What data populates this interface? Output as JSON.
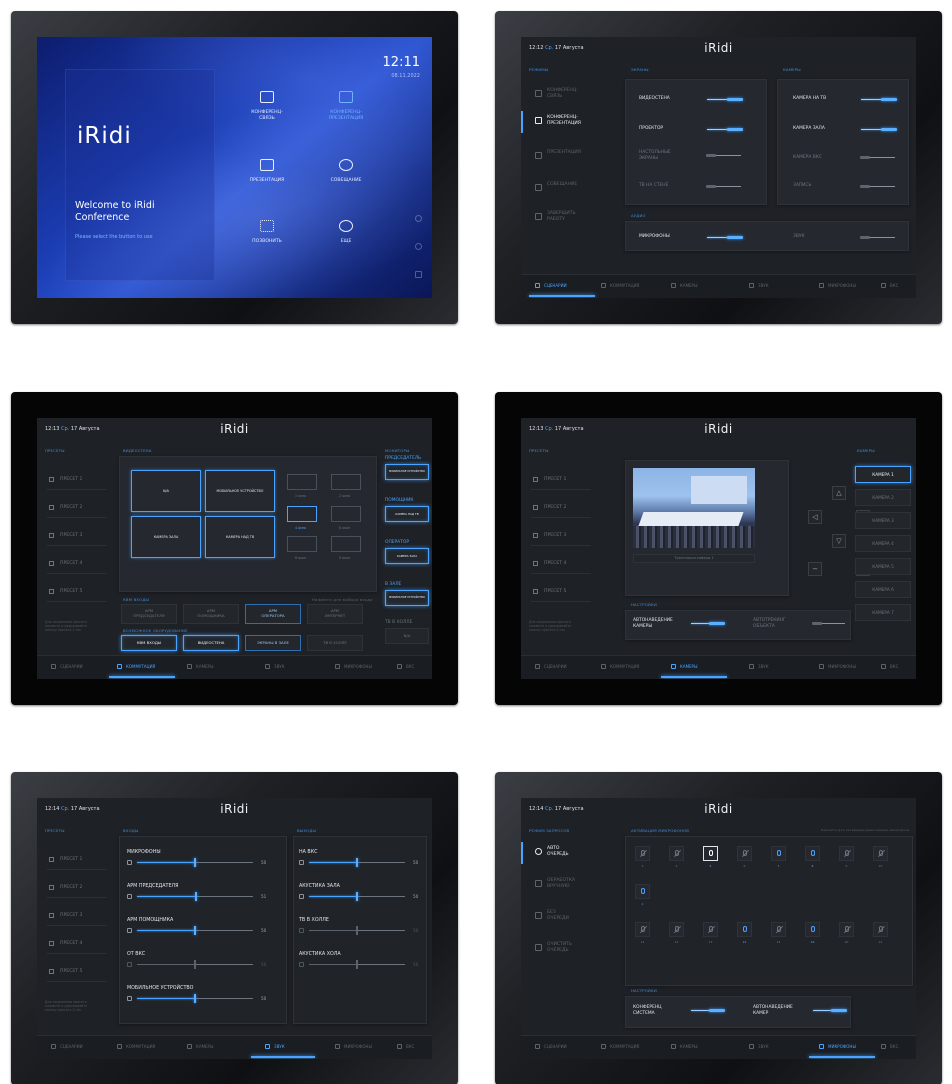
{
  "welcome": {
    "logo": "iRidi",
    "title": "Welcome to iRidi Conference",
    "subtitle": "Please select the button to use",
    "time": "12:11",
    "date": "08.11.2022",
    "items": [
      {
        "label": "КОНФЕРЕНЦ-\nСВЯЗЬ",
        "icon": "video-conference-icon"
      },
      {
        "label": "КОНФЕРЕНЦ-\nПРЕЗЕНТАЦИЯ",
        "icon": "conference-presentation-icon"
      },
      {
        "label": "ПРЕЗЕНТАЦИЯ",
        "icon": "presentation-icon"
      },
      {
        "label": "СОВЕЩАНИЕ",
        "icon": "meeting-icon"
      },
      {
        "label": "ПОЗВОНИТЬ",
        "icon": "dialpad-icon"
      },
      {
        "label": "ЕЩЕ",
        "icon": "more-icon"
      }
    ]
  },
  "logo": "iRidi",
  "tabs": [
    "СЦЕНАРИИ",
    "КОММУТАЦИЯ",
    "КАМЕРЫ",
    "ЗВУК",
    "МИКРОФОНЫ",
    "ВКС"
  ],
  "screen_modes": {
    "time": "12:12",
    "day": "Ср.",
    "date": "17 Августа",
    "sec_modes": "РЕЖИМЫ",
    "sec_screens": "ЭКРАНЫ",
    "sec_cameras": "КАМЕРЫ",
    "sec_audio": "АУДИО",
    "menu": [
      {
        "label": "КОНФЕРЕНЦ-\nСВЯЗЬ"
      },
      {
        "label": "КОНФЕРЕНЦ-\nПРЕЗЕНТАЦИЯ"
      },
      {
        "label": "ПРЕЗЕНТАЦИЯ"
      },
      {
        "label": "СОВЕЩАНИЕ"
      },
      {
        "label": "ЗАВЕРШИТЬ\nРАБОТУ"
      }
    ],
    "screens": [
      {
        "label": "ВИДЕОСТЕНА",
        "on": true
      },
      {
        "label": "ПРОЕКТОР",
        "on": true
      },
      {
        "label": "НАСТОЛЬНЫЕ\nЭКРАНЫ",
        "on": false
      },
      {
        "label": "ТВ НА СТЕНЕ",
        "on": false
      }
    ],
    "cameras": [
      {
        "label": "КАМЕРА НА ТВ",
        "on": true
      },
      {
        "label": "КАМЕРА ЗАЛА",
        "on": true
      },
      {
        "label": "КАМЕРА ВКС",
        "on": false
      },
      {
        "label": "ЗАПИСЬ",
        "on": false
      }
    ],
    "audio": [
      {
        "label": "МИКРОФОНЫ",
        "on": true
      },
      {
        "label": "ЗВУК",
        "on": false
      }
    ]
  },
  "screen_switch": {
    "time": "12:13",
    "day": "Ср.",
    "date": "17 Августа",
    "sec_presets": "ПРЕСЕТЫ",
    "sec_videowall": "ВИДЕОСТЕНА",
    "sec_monitors": "МОНИТОРЫ",
    "sec_km": "КВМ ВХОДЫ",
    "km_hint": "Нажмите для выбора входа",
    "sec_equipment": "ВОЗМОЖНОЕ ОБОРУДОВАНИЕ",
    "presets": [
      "ПРЕСЕТ 1",
      "ПРЕСЕТ 2",
      "ПРЕСЕТ 3",
      "ПРЕСЕТ 4",
      "ПРЕСЕТ 5"
    ],
    "note": "Для сохранения пресета\nнажмите и удерживайте\nкнопку пресета 2 сек",
    "wall_cells": [
      "N/A",
      "МОБИЛЬНОЕ УСТРОЙСТВО",
      "КАМЕРА ЗАЛА",
      "КАМЕРА НАД ТВ"
    ],
    "layouts": [
      "1 окно",
      "2 окна",
      "4 окна",
      "6 окон",
      "8 окон",
      "9 окон"
    ],
    "km_inputs": [
      "АРМ\nПРЕДСЕДАТЕЛЯ",
      "АРМ\nПОМОЩНИКА",
      "АРМ\nОПЕРАТОРА",
      "АРМ\nИНТЕРНЕТ"
    ],
    "equipment": [
      "КВМ ВХОДЫ",
      "ВИДЕОСТЕНА",
      "ЭКРАНЫ В ЗАЛЕ",
      "ТВ В ХОЛЛЕ"
    ],
    "monitors": [
      {
        "label": "ПРЕДСЕДАТЕЛЬ",
        "value": "МОБИЛЬНОЕ УСТРОЙСТВО"
      },
      {
        "label": "ПОМОЩНИК",
        "value": "КАМЕРА НАД ТВ"
      },
      {
        "label": "ОПЕРАТОР",
        "value": "КАМЕРА ЗАЛА"
      },
      {
        "label": "В ЗАЛЕ",
        "value": "МОБИЛЬНОЕ УСТРОЙСТВО"
      },
      {
        "label": "ТВ В ХОЛЛЕ",
        "value": "N/A"
      }
    ]
  },
  "screen_cameras": {
    "time": "12:13",
    "day": "Ср.",
    "date": "17 Августа",
    "sec_presets": "ПРЕСЕТЫ",
    "sec_cameras": "КАМЕРЫ",
    "sec_settings": "НАСТРОЙКИ",
    "presets": [
      "ПРЕСЕТ 1",
      "ПРЕСЕТ 2",
      "ПРЕСЕТ 3",
      "ПРЕСЕТ 4",
      "ПРЕСЕТ 5"
    ],
    "note": "Для сохранения пресета\nнажмите и удерживайте\nкнопку пресета 2 сек",
    "caption": "Трансляция камеры 1",
    "auto_cam": "АВТОНАВЕДЕНИЕ\nКАМЕРЫ",
    "auto_track": "АВТОТРЕКИНГ\nОБЪЕКТА",
    "cameras": [
      "КАМЕРА 1",
      "КАМЕРА 2",
      "КАМЕРА 3",
      "КАМЕРА 4",
      "КАМЕРА 5",
      "КАМЕРА 6",
      "КАМЕРА 7"
    ]
  },
  "screen_sound": {
    "time": "12:14",
    "day": "Ср.",
    "date": "17 Августа",
    "sec_presets": "ПРЕСЕТЫ",
    "sec_inputs": "ВХОДЫ",
    "sec_outputs": "ВЫХОДЫ",
    "presets": [
      "ПРЕСЕТ 1",
      "ПРЕСЕТ 2",
      "ПРЕСЕТ 3",
      "ПРЕСЕТ 4",
      "ПРЕСЕТ 5"
    ],
    "note": "Для сохранения пресета\nнажмите и удерживайте\nкнопку пресета 2 сек",
    "inputs": [
      {
        "label": "МИКРОФОНЫ",
        "value": "50",
        "level": 0.5,
        "on": true
      },
      {
        "label": "АРМ ПРЕДСЕДАТЕЛЯ",
        "value": "51",
        "level": 0.51,
        "on": true
      },
      {
        "label": "АРМ ПОМОЩНИКА",
        "value": "50",
        "level": 0.5,
        "on": true
      },
      {
        "label": "ОТ ВКС",
        "value": "50",
        "level": 0.5,
        "on": false
      },
      {
        "label": "МОБИЛЬНОЕ УСТРОЙСТВО",
        "value": "50",
        "level": 0.5,
        "on": true
      }
    ],
    "outputs": [
      {
        "label": "НА ВКС",
        "value": "50",
        "level": 0.5,
        "on": true
      },
      {
        "label": "АКУСТИКА ЗАЛА",
        "value": "50",
        "level": 0.5,
        "on": true
      },
      {
        "label": "ТВ В ХОЛЛЕ",
        "value": "50",
        "level": 0.5,
        "on": false
      },
      {
        "label": "АКУСТИКА ХОЛА",
        "value": "50",
        "level": 0.5,
        "on": false
      }
    ]
  },
  "screen_mics": {
    "time": "12:14",
    "day": "Ср.",
    "date": "17 Августа",
    "sec_modes": "РЕЖИМ ЗАПРОСОВ",
    "sec_activation": "АКТИВАЦИЯ МИКРОФОНОВ",
    "hint": "Нажмите для активации/деактивации микрофона",
    "sec_settings": "НАСТРОЙКИ",
    "menu": [
      {
        "label": "АВТО\nОЧЕРЕДЬ"
      },
      {
        "label": "ОБРАБОТКА\nВРУЧНУЮ"
      },
      {
        "label": "БЕЗ\nОЧЕРЕДИ"
      },
      {
        "label": "ОЧИСТИТЬ\nОЧЕРЕДЬ"
      }
    ],
    "mics_row1": [
      {
        "n": "3",
        "state": "off"
      },
      {
        "n": "4",
        "state": "off"
      },
      {
        "n": "5",
        "state": "active"
      },
      {
        "n": "6",
        "state": "off"
      },
      {
        "n": "7",
        "state": "on"
      },
      {
        "n": "8",
        "state": "on"
      },
      {
        "n": "9",
        "state": "off"
      },
      {
        "n": "10",
        "state": "off"
      }
    ],
    "mics_row2": [
      {
        "n": "1",
        "state": "on"
      }
    ],
    "mics_row3": [
      {
        "n": "11",
        "state": "off"
      },
      {
        "n": "12",
        "state": "off"
      },
      {
        "n": "13",
        "state": "off"
      },
      {
        "n": "14",
        "state": "on"
      },
      {
        "n": "15",
        "state": "off"
      },
      {
        "n": "16",
        "state": "on"
      },
      {
        "n": "20",
        "state": "off"
      },
      {
        "n": "21",
        "state": "off"
      }
    ],
    "conf_system": "КОНФЕРЕНЦ\nСИСТЕМА",
    "auto_cams": "АВТОНАВЕДЕНИЕ\nКАМЕР"
  }
}
